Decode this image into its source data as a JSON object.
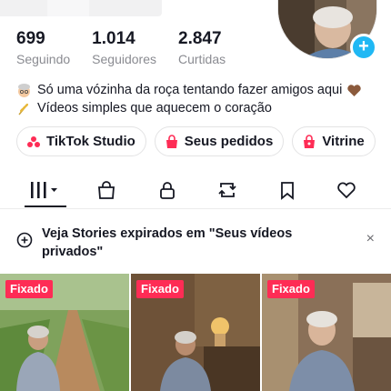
{
  "profile": {
    "stats": [
      {
        "value": "699",
        "label": "Seguindo"
      },
      {
        "value": "1.014",
        "label": "Seguidores"
      },
      {
        "value": "2.847",
        "label": "Curtidas"
      }
    ],
    "bio_lines": [
      {
        "icon": "grandma-emoji-icon",
        "text": "Só uma vózinha da roça tentando fazer amigos aqui",
        "trail_icon": "brown-heart-icon"
      },
      {
        "icon": "wheat-emoji-icon",
        "text": "Vídeos simples que aquecem o coração"
      }
    ]
  },
  "chips": [
    {
      "label": "TikTok Studio",
      "icon": "people-icon"
    },
    {
      "label": "Seus pedidos",
      "icon": "bag-icon"
    },
    {
      "label": "Vitrine",
      "icon": "shop-icon"
    }
  ],
  "tabs": [
    "videos-grid-icon",
    "shop-bag-icon",
    "lock-icon",
    "repost-icon",
    "bookmark-icon",
    "heart-icon"
  ],
  "stories_banner": {
    "text": "Veja Stories expirados em \"Seus vídeos privados\"",
    "close": "×"
  },
  "videos": [
    {
      "badge": "Fixado"
    },
    {
      "badge": "Fixado"
    },
    {
      "badge": "Fixado"
    }
  ],
  "colors": {
    "accent": "#fe2c55",
    "plus": "#20b8f4",
    "text": "#161823",
    "muted": "#8a8b91"
  }
}
